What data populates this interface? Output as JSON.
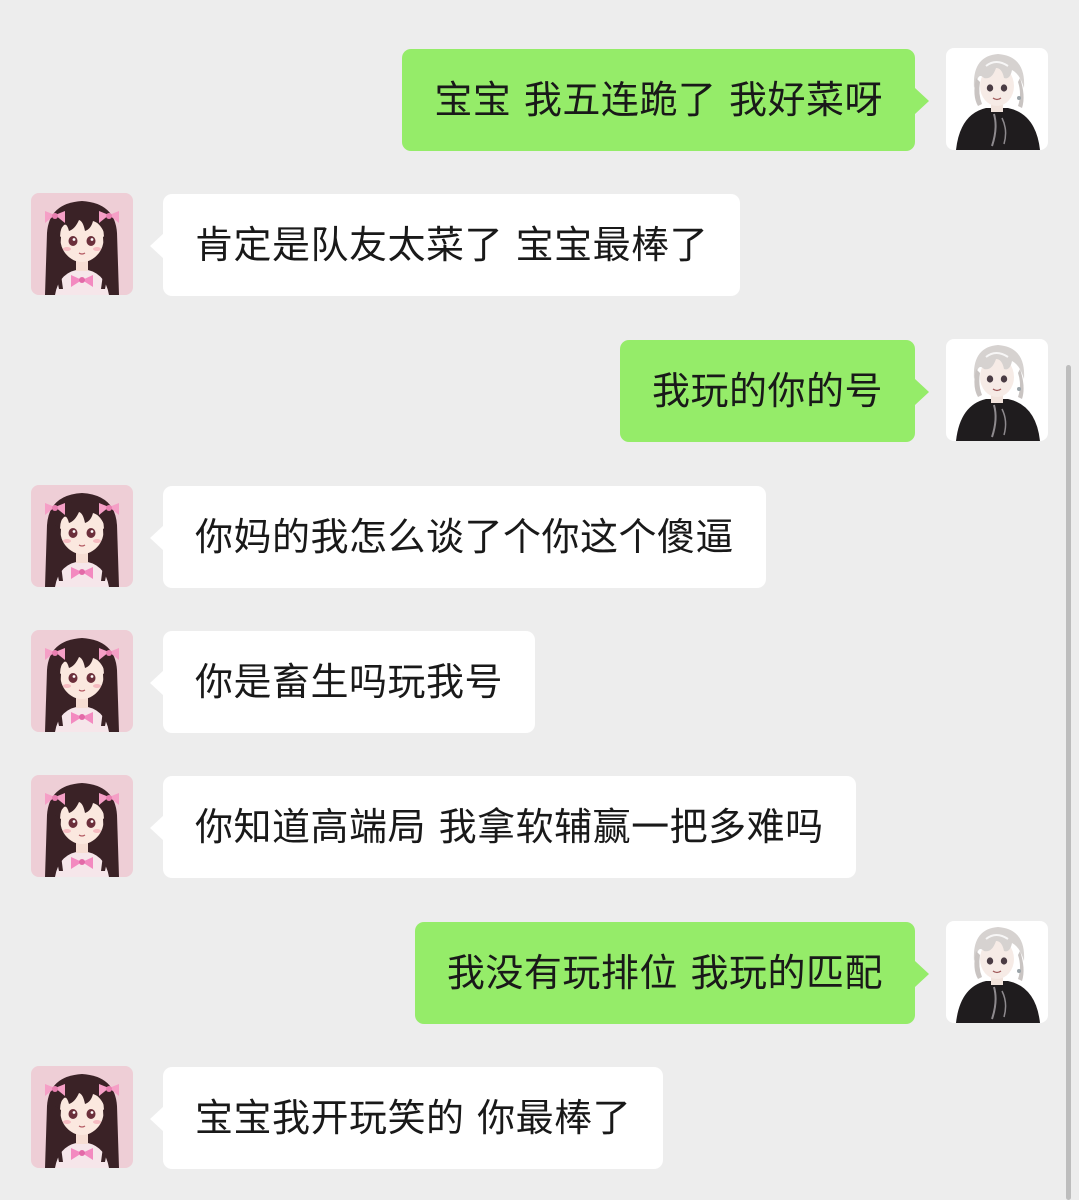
{
  "colors": {
    "background": "#ededed",
    "sent_bubble": "#95ec69",
    "received_bubble": "#ffffff",
    "text": "#191919"
  },
  "messages": [
    {
      "side": "right",
      "sender": "me",
      "avatar": "white-haired-boy-avatar",
      "text": "宝宝 我五连跪了 我好菜呀"
    },
    {
      "side": "left",
      "sender": "partner",
      "avatar": "dark-haired-girl-avatar",
      "text": "肯定是队友太菜了 宝宝最棒了"
    },
    {
      "side": "right",
      "sender": "me",
      "avatar": "white-haired-boy-avatar",
      "text": "我玩的你的号"
    },
    {
      "side": "left",
      "sender": "partner",
      "avatar": "dark-haired-girl-avatar",
      "text": "你妈的我怎么谈了个你这个傻逼"
    },
    {
      "side": "left",
      "sender": "partner",
      "avatar": "dark-haired-girl-avatar",
      "text": "你是畜生吗玩我号"
    },
    {
      "side": "left",
      "sender": "partner",
      "avatar": "dark-haired-girl-avatar",
      "text": "你知道高端局 我拿软辅赢一把多难吗"
    },
    {
      "side": "right",
      "sender": "me",
      "avatar": "white-haired-boy-avatar",
      "text": "我没有玩排位 我玩的匹配"
    },
    {
      "side": "left",
      "sender": "partner",
      "avatar": "dark-haired-girl-avatar",
      "text": "宝宝我开玩笑的 你最棒了"
    }
  ]
}
